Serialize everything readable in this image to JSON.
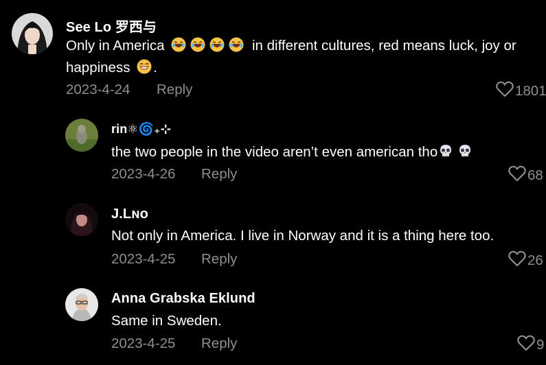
{
  "accent_colors": {
    "meta_gray": "#8e8e8e",
    "background": "#000000",
    "text": "#ffffff"
  },
  "comments": [
    {
      "username": "See Lo 罗西与",
      "text_line1": "Only in America",
      "emoji_line1": [
        "laughing-face-emoji",
        "laughing-face-emoji",
        "laughing-face-emoji",
        "laughing-face-emoji"
      ],
      "text_line1_after": "in different cultures, red means luck, joy or",
      "text_line2": "happiness",
      "emoji_line2": "grinning-face-emoji",
      "text_line2_after": ".",
      "date": "2023-4-24",
      "reply_label": "Reply",
      "likes": "1801"
    },
    {
      "username": "rin⚛︎🌀₊⊹",
      "text": "the two people in the video aren’t even american tho",
      "emojis": [
        "skull-emoji",
        "skull-emoji"
      ],
      "date": "2023-4-26",
      "reply_label": "Reply",
      "likes": "68"
    },
    {
      "username": "J.Lɴᴏ",
      "text": "Not only in America. I live in Norway and it is a thing here too.",
      "date": "2023-4-25",
      "reply_label": "Reply",
      "likes": "26"
    },
    {
      "username": "Anna Grabska Eklund",
      "text": "Same in Sweden.",
      "date": "2023-4-25",
      "reply_label": "Reply",
      "likes": "9"
    }
  ]
}
